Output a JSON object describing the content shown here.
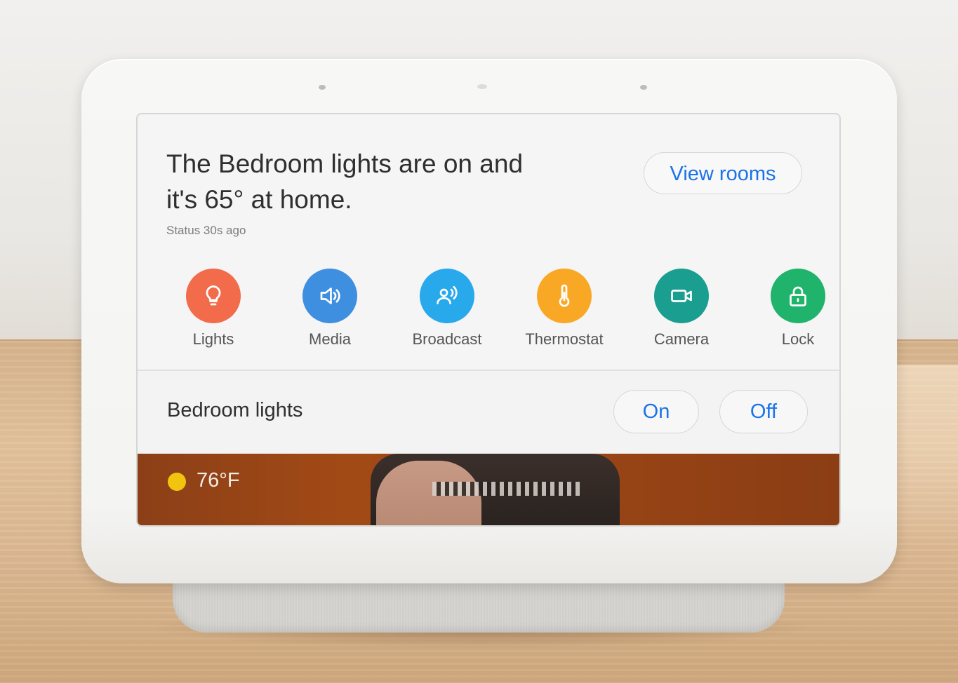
{
  "scene": {
    "colors": {
      "wall": "#efeeec",
      "table": "#dcb993",
      "device": "#f5f5f3"
    }
  },
  "screen": {
    "headline": {
      "line1": "The Bedroom lights are on and",
      "line2": "it's 65° at home."
    },
    "status": "Status 30s ago",
    "view_rooms_label": "View rooms",
    "actions": [
      {
        "label": "Lights",
        "icon": "lightbulb-icon",
        "color": "#f26b4b"
      },
      {
        "label": "Media",
        "icon": "speaker-icon",
        "color": "#3e8fe0"
      },
      {
        "label": "Broadcast",
        "icon": "broadcast-icon",
        "color": "#28a9ec"
      },
      {
        "label": "Thermostat",
        "icon": "thermometer-icon",
        "color": "#f9a825"
      },
      {
        "label": "Camera",
        "icon": "camera-icon",
        "color": "#1a9e8f"
      },
      {
        "label": "Lock",
        "icon": "lock-icon",
        "color": "#20b36b"
      }
    ],
    "bedroom_lights": {
      "label": "Bedroom lights",
      "on_label": "On",
      "off_label": "Off"
    },
    "ambient": {
      "weather_icon": "sun-icon",
      "temperature": "76°F"
    },
    "colors": {
      "accent": "#1a73e8",
      "sun": "#f2c30f"
    }
  }
}
